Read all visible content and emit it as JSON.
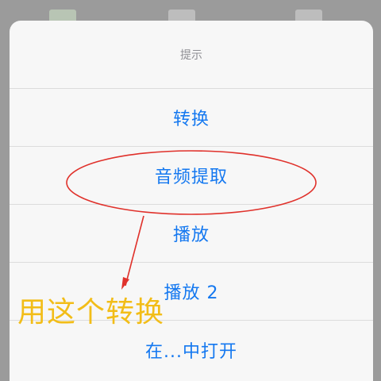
{
  "dialog": {
    "title": "提示",
    "actions": [
      {
        "label": "转换"
      },
      {
        "label": "音频提取"
      },
      {
        "label": "播放"
      },
      {
        "label": "播放 2"
      },
      {
        "label": "在...中打开"
      }
    ]
  },
  "annotation": {
    "note": "用这个转换",
    "color": "#f2bd18",
    "circle_color": "#e0312b",
    "arrow_color": "#e0312b"
  },
  "colors": {
    "action_text": "#1478f0",
    "title_text": "#8e8e93",
    "sheet_bg": "#f7f7f7",
    "backdrop": "#9b9b9b"
  },
  "icons": [
    "file-icon",
    "file-icon",
    "file-icon"
  ]
}
